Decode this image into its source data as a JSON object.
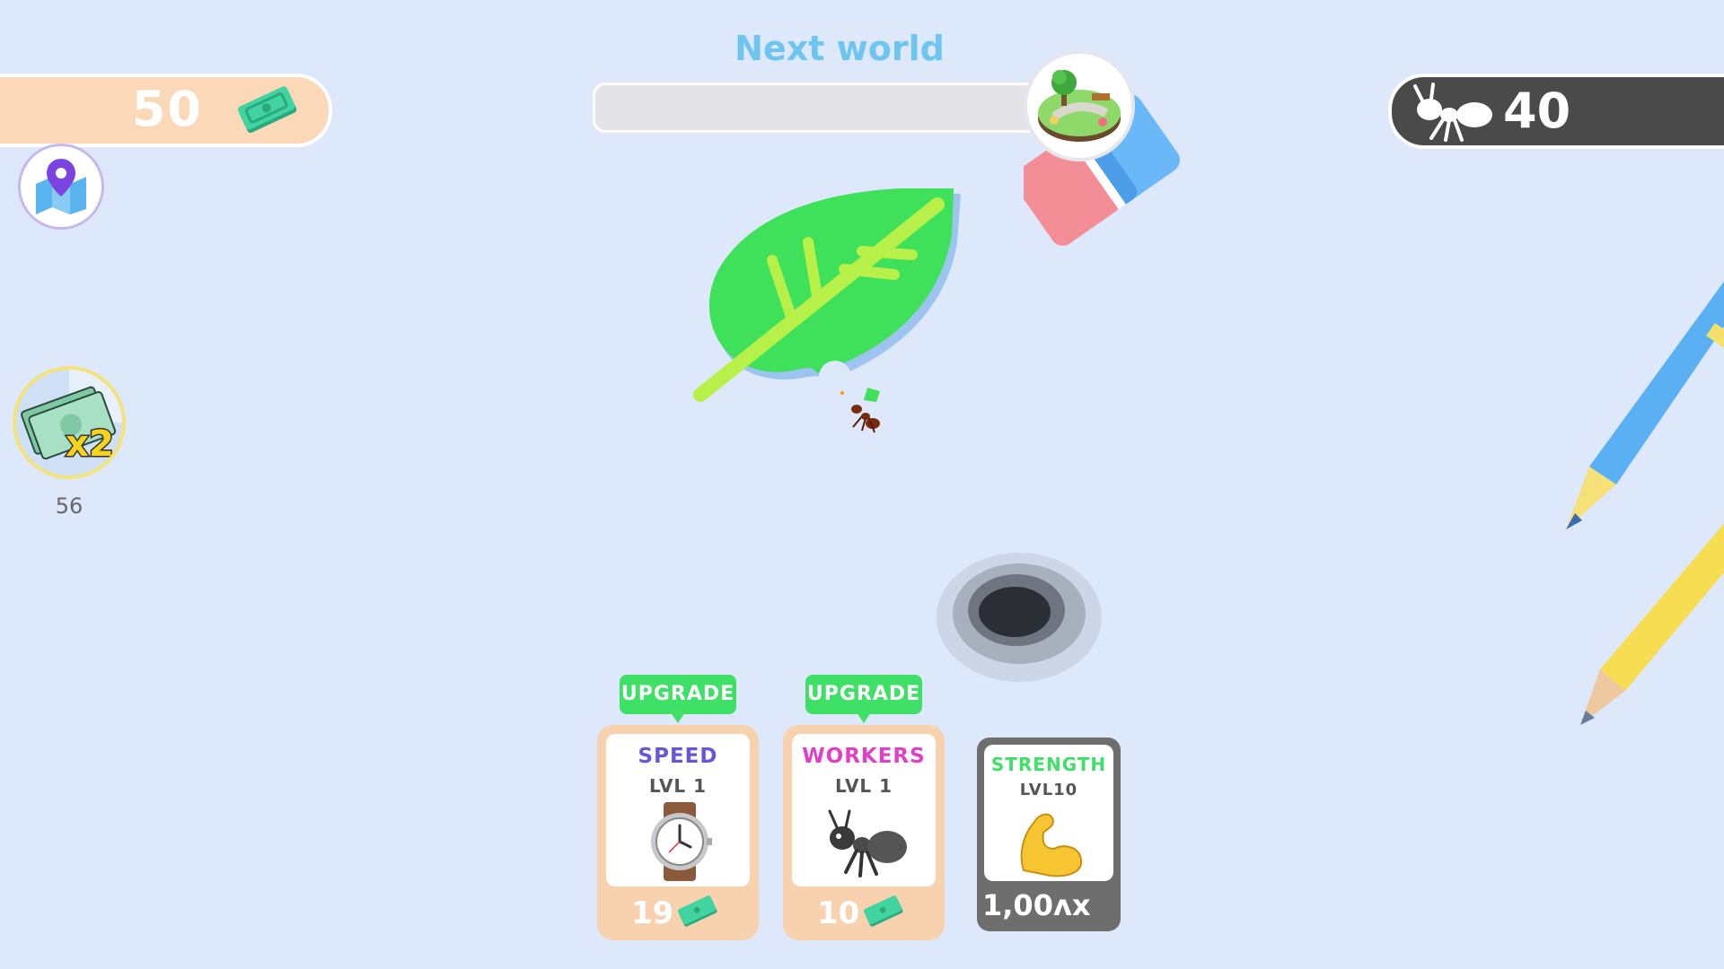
{
  "hud": {
    "money": "50",
    "ant_count": "40",
    "next_world_label": "Next world",
    "next_world_progress": 0,
    "boost_label": "x2",
    "boost_timer": "56"
  },
  "icons": {
    "money": "banknote-icon",
    "map": "map-pin-icon",
    "ant": "ant-icon",
    "world": "park-world-icon",
    "boost": "money-x2-icon"
  },
  "upgrades": [
    {
      "tag": "UPGRADE",
      "title": "SPEED",
      "level": "LVL 1",
      "price": "19",
      "title_color": "#6a55d8",
      "icon": "wristwatch-icon"
    },
    {
      "tag": "UPGRADE",
      "title": "WORKERS",
      "level": "LVL 1",
      "price": "10",
      "title_color": "#e23fc8",
      "icon": "ant-icon"
    },
    {
      "title": "STRENGTH",
      "level": "LVL10",
      "value": "1,00ʌx",
      "title_color": "#3ee065",
      "icon": "flexed-biceps-icon"
    }
  ],
  "colors": {
    "background": "#dde8fb",
    "upgrade_green": "#3ee065",
    "money_bar": "#fad8b8",
    "ant_bar": "#4a4a4a"
  }
}
